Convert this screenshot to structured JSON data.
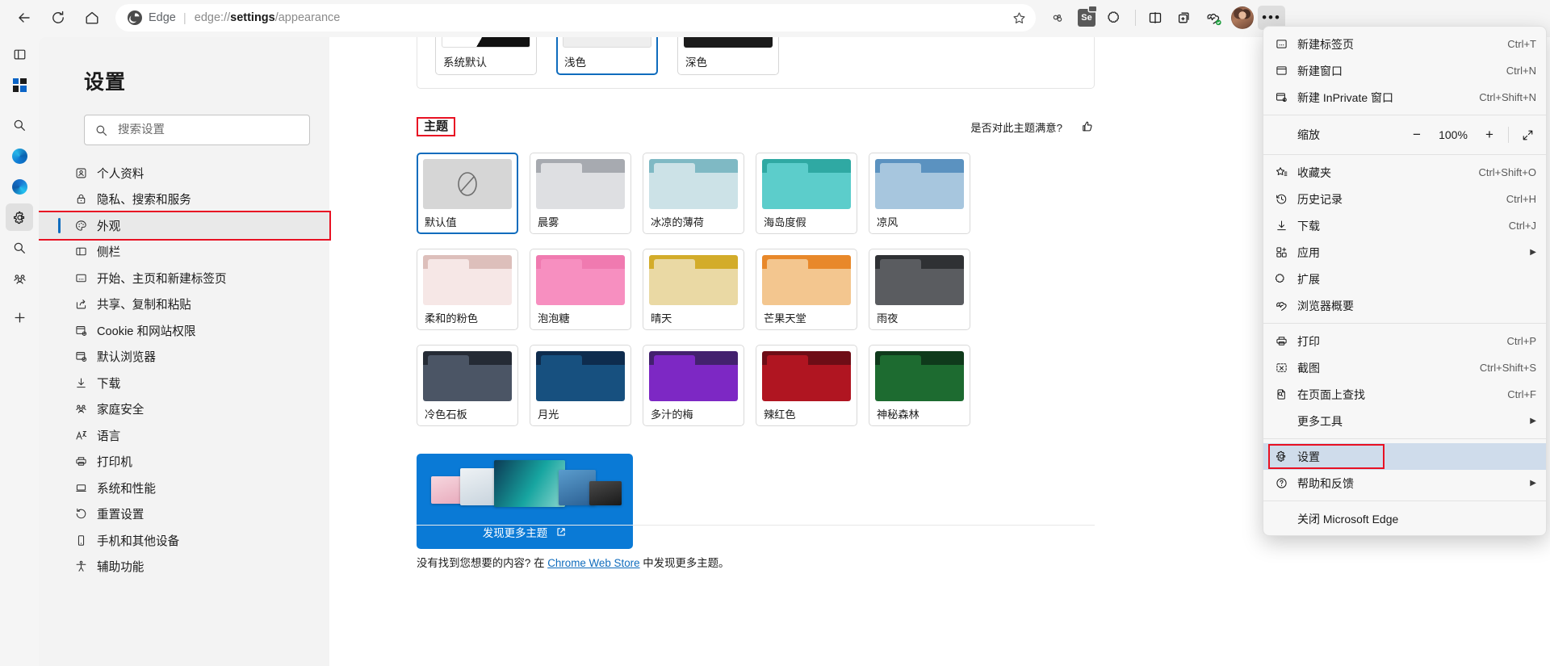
{
  "browser": {
    "back_tooltip": "后退",
    "refresh_tooltip": "刷新",
    "home_tooltip": "主页",
    "omnibox": {
      "brand": "Edge",
      "separator": "|",
      "url_prefix": "edge://",
      "url_bold": "settings",
      "url_suffix": "/appearance",
      "full_url": "edge://settings/appearance"
    },
    "toolbar_icons": [
      {
        "name": "split-screen-icon"
      },
      {
        "name": "selenium-ide-icon",
        "label": "Se"
      },
      {
        "name": "extensions-puzzle-icon"
      },
      {
        "name": "browser-essentials-icon"
      },
      {
        "name": "collections-icon"
      },
      {
        "name": "profile-avatar"
      },
      {
        "name": "settings-and-more-button"
      }
    ]
  },
  "rail": {
    "items": [
      {
        "name": "sidebar-toggle-icon"
      },
      {
        "name": "microsoft-365-icon"
      },
      {
        "name": "search-icon"
      },
      {
        "name": "bing-chat-icon"
      },
      {
        "name": "copilot-icon"
      },
      {
        "name": "settings-gear-icon",
        "selected": true
      },
      {
        "name": "search-alt-icon"
      },
      {
        "name": "family-icon"
      },
      {
        "name": "add-tool-icon"
      }
    ]
  },
  "settings": {
    "title": "设置",
    "search": {
      "placeholder": "搜索设置",
      "value": ""
    },
    "nav_items": [
      {
        "label": "个人资料",
        "icon": "profile-icon"
      },
      {
        "label": "隐私、搜索和服务",
        "icon": "lock-icon"
      },
      {
        "label": "外观",
        "icon": "palette-icon",
        "active": true,
        "highlighted": true
      },
      {
        "label": "侧栏",
        "icon": "sidebar-icon"
      },
      {
        "label": "开始、主页和新建标签页",
        "icon": "home-page-icon"
      },
      {
        "label": "共享、复制和粘贴",
        "icon": "share-icon"
      },
      {
        "label": "Cookie 和网站权限",
        "icon": "cookie-icon"
      },
      {
        "label": "默认浏览器",
        "icon": "default-browser-icon"
      },
      {
        "label": "下载",
        "icon": "download-icon"
      },
      {
        "label": "家庭安全",
        "icon": "family-safety-icon"
      },
      {
        "label": "语言",
        "icon": "language-icon"
      },
      {
        "label": "打印机",
        "icon": "printer-icon"
      },
      {
        "label": "系统和性能",
        "icon": "system-icon"
      },
      {
        "label": "重置设置",
        "icon": "reset-icon"
      },
      {
        "label": "手机和其他设备",
        "icon": "phone-icon"
      },
      {
        "label": "辅助功能",
        "icon": "accessibility-icon"
      }
    ]
  },
  "appearance": {
    "modes": [
      {
        "label": "系统默认",
        "preview": "system",
        "selected": false
      },
      {
        "label": "浅色",
        "preview": "light",
        "selected": true
      },
      {
        "label": "深色",
        "preview": "dark",
        "selected": false
      }
    ],
    "theme_heading": "主题",
    "feedback_text": "是否对此主题满意?",
    "feedback_icon": "thumbs-up-icon",
    "themes": [
      {
        "label": "默认值",
        "kind": "none",
        "selected": true
      },
      {
        "label": "晨雾",
        "tab": "#a7aab0",
        "strip": "#a7aab0",
        "body": "#dedfe2"
      },
      {
        "label": "冰凉的薄荷",
        "tab": "#7fb9c4",
        "strip": "#7fb9c4",
        "body": "#cce2e7"
      },
      {
        "label": "海岛度假",
        "tab": "#2fa9a3",
        "strip": "#2fa9a3",
        "body": "#5ccdcb"
      },
      {
        "label": "凉风",
        "tab": "#5b92c0",
        "strip": "#5b92c0",
        "body": "#a7c6de"
      },
      {
        "label": "柔和的粉色",
        "tab": "#ddbfbb",
        "strip": "#ddbfbb",
        "body": "#f6e7e6"
      },
      {
        "label": "泡泡糖",
        "tab": "#f07ab0",
        "strip": "#f07ab0",
        "body": "#f78fc0"
      },
      {
        "label": "晴天",
        "tab": "#d3ac2a",
        "strip": "#d3ac2a",
        "body": "#ead9a4"
      },
      {
        "label": "芒果天堂",
        "tab": "#e8882a",
        "strip": "#e8882a",
        "body": "#f3c68f"
      },
      {
        "label": "雨夜",
        "tab": "#2f3134",
        "strip": "#2f3134",
        "body": "#5a5c60"
      },
      {
        "label": "冷色石板",
        "tab": "#252b35",
        "strip": "#252b35",
        "body": "#4b5565"
      },
      {
        "label": "月光",
        "tab": "#0e2c4e",
        "strip": "#0e2c4e",
        "body": "#17507f"
      },
      {
        "label": "多汁的梅",
        "tab": "#43216e",
        "strip": "#43216e",
        "body": "#7d28c4"
      },
      {
        "label": "辣红色",
        "tab": "#6e0d16",
        "strip": "#6e0d16",
        "body": "#b01521"
      },
      {
        "label": "神秘森林",
        "tab": "#0f3a1b",
        "strip": "#0f3a1b",
        "body": "#1d6b30"
      }
    ],
    "discover": {
      "label": "发现更多主题",
      "external_icon": "open-in-new-icon"
    },
    "footer": {
      "prefix": "没有找到您想要的内容? 在 ",
      "link": "Chrome Web Store",
      "suffix": " 中发现更多主题。"
    }
  },
  "edge_menu": {
    "items": [
      {
        "type": "item",
        "label": "新建标签页",
        "shortcut": "Ctrl+T",
        "icon": "new-tab-icon"
      },
      {
        "type": "item",
        "label": "新建窗口",
        "shortcut": "Ctrl+N",
        "icon": "new-window-icon"
      },
      {
        "type": "item",
        "label": "新建 InPrivate 窗口",
        "shortcut": "Ctrl+Shift+N",
        "icon": "inprivate-icon"
      },
      {
        "type": "separator"
      },
      {
        "type": "zoom",
        "label": "缩放",
        "value": "100%",
        "minus": "−",
        "plus": "+",
        "fullscreen_icon": "fullscreen-icon"
      },
      {
        "type": "separator"
      },
      {
        "type": "item",
        "label": "收藏夹",
        "shortcut": "Ctrl+Shift+O",
        "icon": "favorites-star-icon"
      },
      {
        "type": "item",
        "label": "历史记录",
        "shortcut": "Ctrl+H",
        "icon": "history-icon"
      },
      {
        "type": "item",
        "label": "下载",
        "shortcut": "Ctrl+J",
        "icon": "download-icon"
      },
      {
        "type": "item",
        "label": "应用",
        "shortcut": "",
        "icon": "apps-icon",
        "submenu": true
      },
      {
        "type": "item",
        "label": "扩展",
        "shortcut": "",
        "icon": "extensions-icon"
      },
      {
        "type": "item",
        "label": "浏览器概要",
        "shortcut": "",
        "icon": "browser-essentials-icon"
      },
      {
        "type": "separator"
      },
      {
        "type": "item",
        "label": "打印",
        "shortcut": "Ctrl+P",
        "icon": "print-icon"
      },
      {
        "type": "item",
        "label": "截图",
        "shortcut": "Ctrl+Shift+S",
        "icon": "screenshot-icon"
      },
      {
        "type": "item",
        "label": "在页面上查找",
        "shortcut": "Ctrl+F",
        "icon": "find-on-page-icon"
      },
      {
        "type": "item",
        "label": "更多工具",
        "shortcut": "",
        "icon": "",
        "submenu": true,
        "noicon": true
      },
      {
        "type": "separator"
      },
      {
        "type": "item",
        "label": "设置",
        "shortcut": "",
        "icon": "settings-gear-icon",
        "highlighted": true,
        "boxed": true
      },
      {
        "type": "item",
        "label": "帮助和反馈",
        "shortcut": "",
        "icon": "help-icon",
        "submenu": true
      },
      {
        "type": "item",
        "label": "关闭 Microsoft Edge",
        "shortcut": "",
        "icon": "",
        "noicon": true
      }
    ]
  },
  "colors": {
    "accent": "#0f6cbd",
    "highlight_box": "#e81123",
    "menu_highlight": "#cfdceb",
    "discover_bg": "#0a7ad6"
  }
}
